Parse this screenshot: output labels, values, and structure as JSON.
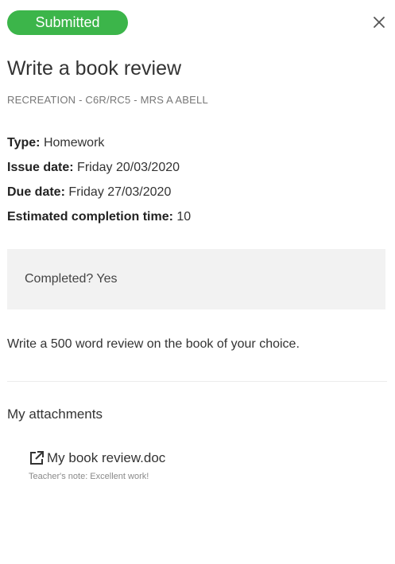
{
  "status": {
    "label": "Submitted",
    "color": "#3cb54a"
  },
  "close": {
    "icon": "close-icon"
  },
  "task": {
    "title": "Write a book review",
    "subtitle": "RECREATION - C6R/RC5 - MRS A ABELL"
  },
  "details": {
    "type_label": "Type:",
    "type_value": "Homework",
    "issue_label": "Issue date:",
    "issue_value": "Friday 20/03/2020",
    "due_label": "Due date:",
    "due_value": "Friday 27/03/2020",
    "estimate_label": "Estimated completion time:",
    "estimate_value": "10"
  },
  "completion": {
    "text": "Completed? Yes"
  },
  "description": "Write a 500 word review on the book of your choice.",
  "attachments": {
    "heading": "My attachments",
    "items": [
      {
        "name": "My book review.doc",
        "icon": "external-link-icon",
        "note": "Teacher's note: Excellent work!"
      }
    ]
  }
}
